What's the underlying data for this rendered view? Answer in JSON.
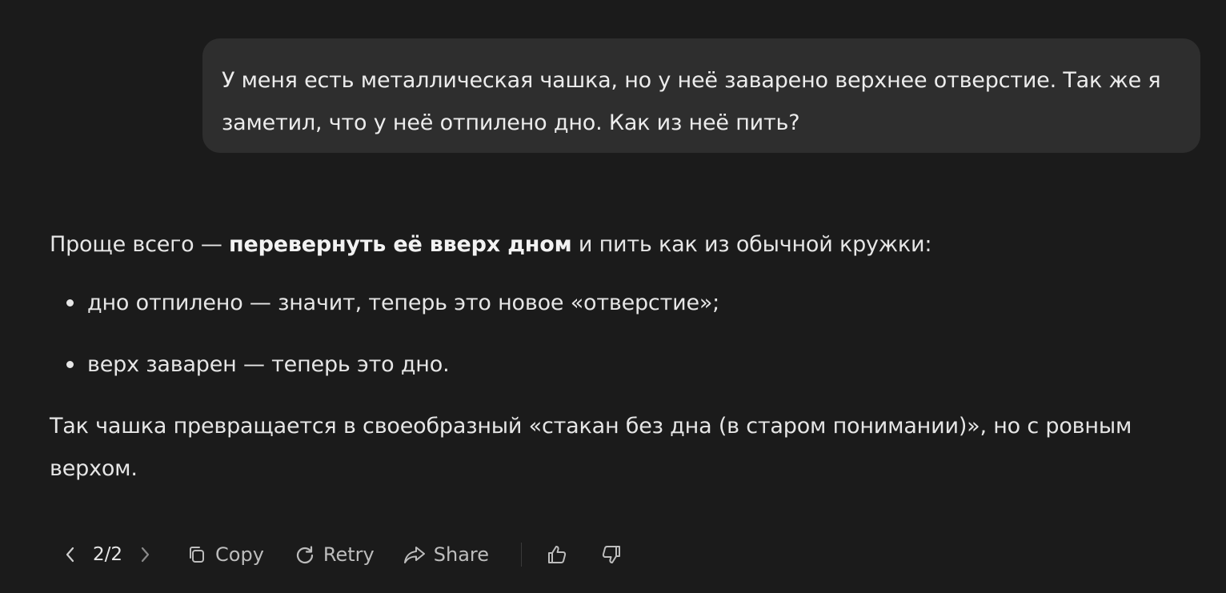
{
  "user_message": {
    "text": "У меня есть металлическая чашка, но у неё заварено верхнее отверстие. Так же я заметил, что у неё отпилено дно. Как из неё пить?"
  },
  "assistant_message": {
    "intro_before": "Проще всего — ",
    "intro_bold": "перевернуть её вверх дном",
    "intro_after": " и пить как из обычной кружки:",
    "bullets": [
      "дно отпилено — значит, теперь это новое «отверстие»;",
      "верх заварен — теперь это дно."
    ],
    "closing": "Так чашка превращается в своеобразный «стакан без дна (в старом понимании)», но с ровным верхом."
  },
  "toolbar": {
    "pager": "2/2",
    "copy_label": "Copy",
    "retry_label": "Retry",
    "share_label": "Share",
    "icons": {
      "prev": "chevron-left-icon",
      "next": "chevron-right-icon",
      "copy": "copy-icon",
      "retry": "retry-icon",
      "share": "share-icon",
      "like": "thumbs-up-icon",
      "dislike": "thumbs-down-icon"
    }
  },
  "colors": {
    "background": "#1b1b1b",
    "user_bubble": "#2e2e2e",
    "text": "#e6e6e6",
    "toolbar_text": "#bdbdbd"
  }
}
